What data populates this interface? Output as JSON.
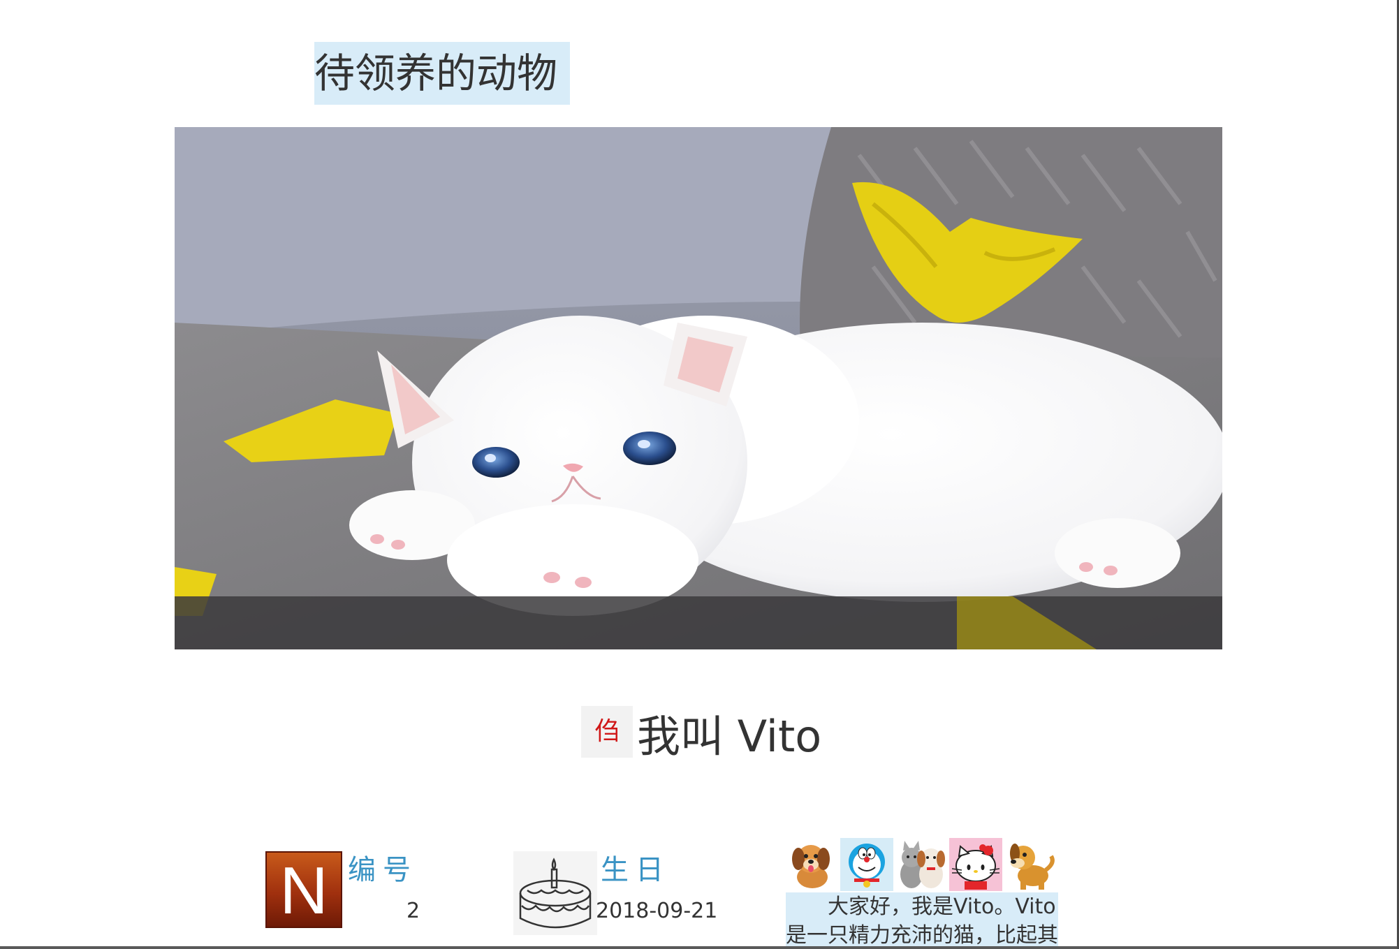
{
  "page": {
    "title": "待领养的动物"
  },
  "hero": {
    "icon": "white-kitten-photo"
  },
  "pet": {
    "badge_glyph": "㑇",
    "name_heading": "我叫 Vito"
  },
  "info": {
    "number_label": "编号",
    "number_value": "2",
    "number_icon": "n-letter-icon",
    "birthday_label": "生日",
    "birthday_value": "2018-09-21",
    "birthday_icon": "birthday-cake-icon",
    "avatars": [
      "puppy-icon",
      "doraemon-icon",
      "cat-and-dog-icon",
      "hello-kitty-icon",
      "puppy-icon"
    ],
    "intro_text": "大家好，我是Vito。Vito是一只精力充沛的猫，比起其"
  },
  "colors": {
    "title_bg": "#d8ecf8",
    "label_color": "#3a93c4",
    "badge_glyph_color": "#d01818"
  }
}
